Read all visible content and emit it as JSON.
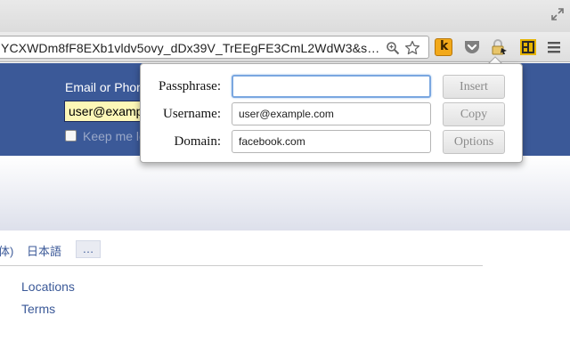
{
  "browser": {
    "url": "YCXWDm8fF8EXb1vldv5ovy_dDx39V_TrEEgFE3CmL2WdW3&s…",
    "extensions": [
      {
        "name": "k-extension-icon",
        "glyph": "k"
      },
      {
        "name": "pocket-icon"
      },
      {
        "name": "password-lock-icon"
      },
      {
        "name": "grid-extension-icon"
      },
      {
        "name": "chrome-menu-icon"
      }
    ]
  },
  "page": {
    "login_label": "Email or Phone",
    "login_value": "user@example.com",
    "keep_label": "Keep me logged in",
    "lang_prev": "体)",
    "lang_jp": "日本語",
    "lang_more": "…",
    "footer_links": [
      "Locations",
      "Terms"
    ],
    "colors": {
      "brand": "#3b5998",
      "field_fill": "#fdf7b7"
    }
  },
  "popup": {
    "passphrase_label": "Passphrase:",
    "passphrase_value": "",
    "username_label": "Username:",
    "username_value": "user@example.com",
    "domain_label": "Domain:",
    "domain_value": "facebook.com",
    "insert_label": "Insert",
    "copy_label": "Copy",
    "options_label": "Options"
  }
}
